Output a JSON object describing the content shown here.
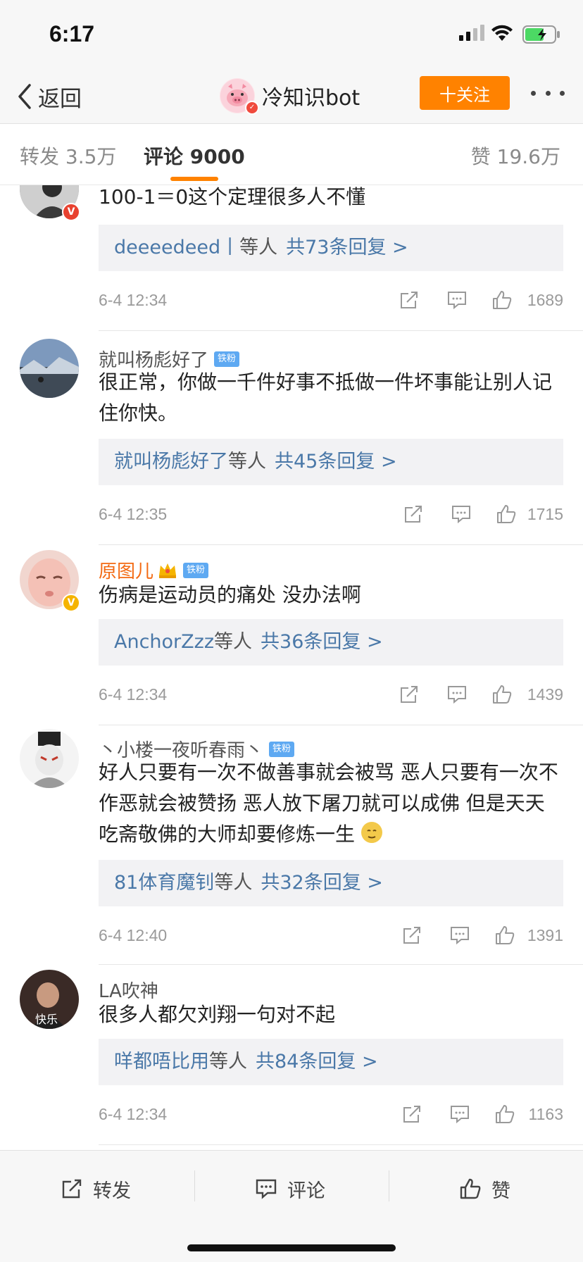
{
  "status_bar": {
    "time": "6:17"
  },
  "nav": {
    "back_label": "返回",
    "title": "冷知识bot",
    "follow_label": "十关注"
  },
  "tabs": [
    {
      "label": "转发 3.5万"
    },
    {
      "label": "评论 9000"
    },
    {
      "label": "赞 19.6万"
    }
  ],
  "fan_badge_label": "铁粉",
  "comments": [
    {
      "username": "",
      "text": "100-1＝0这个定理很多人不懂",
      "reply_name": "deeeedeed丨",
      "reply_suffix": "等人",
      "reply_count": "共73条回复 >",
      "time": "6-4 12:34",
      "likes": "1689",
      "avatar_color": "#6f6f6f",
      "badge": "V"
    },
    {
      "username": "就叫杨彪好了",
      "text": "很正常，你做一千件好事不抵做一件坏事能让别人记住你快。",
      "reply_name": "就叫杨彪好了",
      "reply_suffix": "等人",
      "reply_count": "共45条回复 >",
      "time": "6-4 12:35",
      "likes": "1715",
      "avatar_color": "#6c86a8"
    },
    {
      "username": "原图儿",
      "text": "伤病是运动员的痛处 没办法啊",
      "reply_name": "AnchorZzz",
      "reply_suffix": "等人",
      "reply_count": "共36条回复 >",
      "time": "6-4 12:34",
      "likes": "1439",
      "avatar_color": "#e9b8b4",
      "badge": "V"
    },
    {
      "username": "丶小楼一夜听春雨丶",
      "text": "好人只要有一次不做善事就会被骂 恶人只要有一次不作恶就会被赞扬  恶人放下屠刀就可以成佛 但是天天吃斋敬佛的大师却要修炼一生",
      "reply_name": "81体育魔钊",
      "reply_suffix": "等人",
      "reply_count": "共32条回复 >",
      "time": "6-4 12:40",
      "likes": "1391",
      "avatar_color": "#d9d9d9"
    },
    {
      "username": "LA吹神",
      "text": "很多人都欠刘翔一句对不起",
      "reply_name": "咩都唔比用",
      "reply_suffix": "等人",
      "reply_count": "共84条回复 >",
      "time": "6-4 12:34",
      "likes": "1163",
      "avatar_color": "#3a2a26",
      "avatar_text": "快乐"
    }
  ],
  "toolbar": {
    "repost_label": "转发",
    "comment_label": "评论",
    "like_label": "赞"
  },
  "colors": {
    "accent": "#ff8200",
    "link": "#4a78a8",
    "fan_badge": "#5ea9f2"
  }
}
